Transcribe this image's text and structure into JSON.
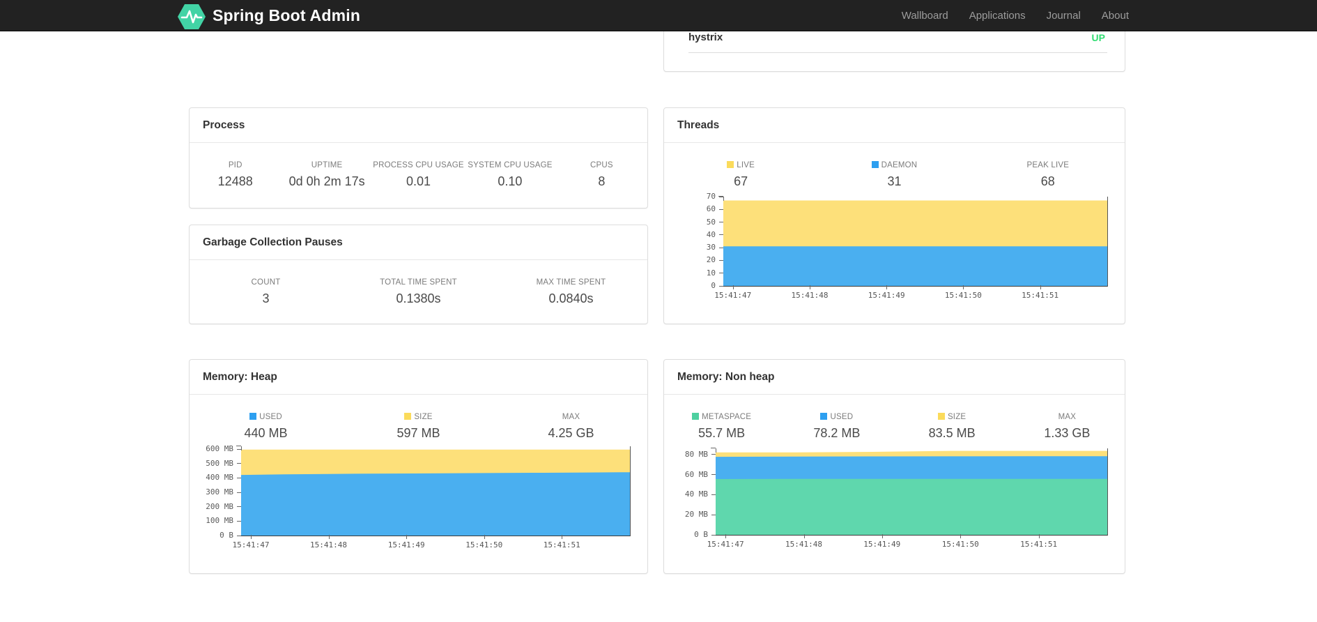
{
  "navbar": {
    "brand": "Spring Boot Admin",
    "items": [
      {
        "label": "Wallboard"
      },
      {
        "label": "Applications"
      },
      {
        "label": "Journal"
      },
      {
        "label": "About"
      }
    ]
  },
  "colors": {
    "navbar_bg": "#222222",
    "brand_green": "#42d3a5",
    "status_up": "#32dd73",
    "area_yellow": "#fde07a",
    "area_blue": "#4aaff0",
    "area_green": "#5fd7ad"
  },
  "health": {
    "application": "hystrix",
    "status": "UP"
  },
  "process": {
    "title": "Process",
    "metrics": [
      {
        "label": "PID",
        "value": "12488"
      },
      {
        "label": "UPTIME",
        "value": "0d 0h 2m 17s"
      },
      {
        "label": "PROCESS CPU USAGE",
        "value": "0.01"
      },
      {
        "label": "SYSTEM CPU USAGE",
        "value": "0.10"
      },
      {
        "label": "CPUS",
        "value": "8"
      }
    ]
  },
  "gc": {
    "title": "Garbage Collection Pauses",
    "metrics": [
      {
        "label": "COUNT",
        "value": "3"
      },
      {
        "label": "TOTAL TIME SPENT",
        "value": "0.1380s"
      },
      {
        "label": "MAX TIME SPENT",
        "value": "0.0840s"
      }
    ]
  },
  "threads": {
    "title": "Threads",
    "metrics": [
      {
        "label": "LIVE",
        "value": "67",
        "marker": "#fbdb5b"
      },
      {
        "label": "DAEMON",
        "value": "31",
        "marker": "#2d9ff0"
      },
      {
        "label": "PEAK LIVE",
        "value": "68"
      }
    ]
  },
  "heap": {
    "title": "Memory: Heap",
    "metrics": [
      {
        "label": "USED",
        "value": "440 MB",
        "marker": "#2d9ff0"
      },
      {
        "label": "SIZE",
        "value": "597 MB",
        "marker": "#fbdb5b"
      },
      {
        "label": "MAX",
        "value": "4.25 GB"
      }
    ]
  },
  "nonheap": {
    "title": "Memory: Non heap",
    "metrics": [
      {
        "label": "METASPACE",
        "value": "55.7 MB",
        "marker": "#4ed0a0"
      },
      {
        "label": "USED",
        "value": "78.2 MB",
        "marker": "#2d9ff0"
      },
      {
        "label": "SIZE",
        "value": "83.5 MB",
        "marker": "#fbdb5b"
      },
      {
        "label": "MAX",
        "value": "1.33 GB"
      }
    ]
  },
  "chart_data": [
    {
      "id": "threads",
      "type": "area",
      "title": "Threads",
      "legend": [
        "LIVE",
        "DAEMON"
      ],
      "current": {
        "LIVE": 67,
        "DAEMON": 31,
        "PEAK LIVE": 68
      },
      "x": [
        "15:41:47",
        "15:41:48",
        "15:41:49",
        "15:41:50",
        "15:41:51"
      ],
      "x_ticks": [
        {
          "label": "15:41:47",
          "frac": 0.025
        },
        {
          "label": "15:41:48",
          "frac": 0.225
        },
        {
          "label": "15:41:49",
          "frac": 0.425
        },
        {
          "label": "15:41:50",
          "frac": 0.625
        },
        {
          "label": "15:41:51",
          "frac": 0.825
        }
      ],
      "ylim": [
        0,
        70
      ],
      "y_ticks": [
        {
          "label": "0",
          "value": 0
        },
        {
          "label": "10",
          "value": 10
        },
        {
          "label": "20",
          "value": 20
        },
        {
          "label": "30",
          "value": 30
        },
        {
          "label": "40",
          "value": 40
        },
        {
          "label": "50",
          "value": 50
        },
        {
          "label": "60",
          "value": 60
        },
        {
          "label": "70",
          "value": 70
        }
      ],
      "series": [
        {
          "name": "LIVE",
          "color": "#fde07a",
          "values": [
            67,
            67
          ]
        },
        {
          "name": "DAEMON",
          "color": "#4aaff0",
          "values": [
            31,
            31
          ]
        }
      ]
    },
    {
      "id": "heap",
      "type": "area",
      "title": "Memory: Heap",
      "legend": [
        "USED",
        "SIZE"
      ],
      "current": {
        "USED": "440 MB",
        "SIZE": "597 MB",
        "MAX": "4.25 GB"
      },
      "x": [
        "15:41:47",
        "15:41:48",
        "15:41:49",
        "15:41:50",
        "15:41:51"
      ],
      "x_ticks": [
        {
          "label": "15:41:47",
          "frac": 0.025
        },
        {
          "label": "15:41:48",
          "frac": 0.225
        },
        {
          "label": "15:41:49",
          "frac": 0.425
        },
        {
          "label": "15:41:50",
          "frac": 0.625
        },
        {
          "label": "15:41:51",
          "frac": 0.825
        }
      ],
      "ylim": [
        0,
        620
      ],
      "unit": "MB",
      "y_ticks": [
        {
          "label": "0 B",
          "value": 0
        },
        {
          "label": "100 MB",
          "value": 100
        },
        {
          "label": "200 MB",
          "value": 200
        },
        {
          "label": "300 MB",
          "value": 300
        },
        {
          "label": "400 MB",
          "value": 400
        },
        {
          "label": "500 MB",
          "value": 500
        },
        {
          "label": "600 MB",
          "value": 600
        }
      ],
      "series": [
        {
          "name": "SIZE",
          "color": "#fde07a",
          "values": [
            597,
            597
          ]
        },
        {
          "name": "USED",
          "color": "#4aaff0",
          "values": [
            421,
            425,
            427,
            430,
            431,
            433,
            435,
            436,
            438,
            440
          ]
        }
      ]
    },
    {
      "id": "nonheap",
      "type": "area",
      "title": "Memory: Non heap",
      "legend": [
        "METASPACE",
        "USED",
        "SIZE"
      ],
      "current": {
        "METASPACE": "55.7 MB",
        "USED": "78.2 MB",
        "SIZE": "83.5 MB",
        "MAX": "1.33 GB"
      },
      "x": [
        "15:41:47",
        "15:41:48",
        "15:41:49",
        "15:41:50",
        "15:41:51"
      ],
      "x_ticks": [
        {
          "label": "15:41:47",
          "frac": 0.025
        },
        {
          "label": "15:41:48",
          "frac": 0.225
        },
        {
          "label": "15:41:49",
          "frac": 0.425
        },
        {
          "label": "15:41:50",
          "frac": 0.625
        },
        {
          "label": "15:41:51",
          "frac": 0.825
        }
      ],
      "ylim": [
        0,
        86
      ],
      "unit": "MB",
      "y_ticks": [
        {
          "label": "0 B",
          "value": 0
        },
        {
          "label": "20 MB",
          "value": 20
        },
        {
          "label": "40 MB",
          "value": 40
        },
        {
          "label": "60 MB",
          "value": 60
        },
        {
          "label": "80 MB",
          "value": 80
        }
      ],
      "series": [
        {
          "name": "SIZE",
          "color": "#fde07a",
          "values": [
            82,
            82,
            82.5,
            83.5,
            83.5,
            83.5
          ]
        },
        {
          "name": "USED",
          "color": "#4aaff0",
          "values": [
            77.6,
            77.9,
            78,
            78.1,
            78.2,
            78.2
          ]
        },
        {
          "name": "METASPACE",
          "color": "#5fd7ad",
          "values": [
            55.5,
            55.6,
            55.7,
            55.7,
            55.7,
            55.7
          ]
        }
      ]
    }
  ]
}
